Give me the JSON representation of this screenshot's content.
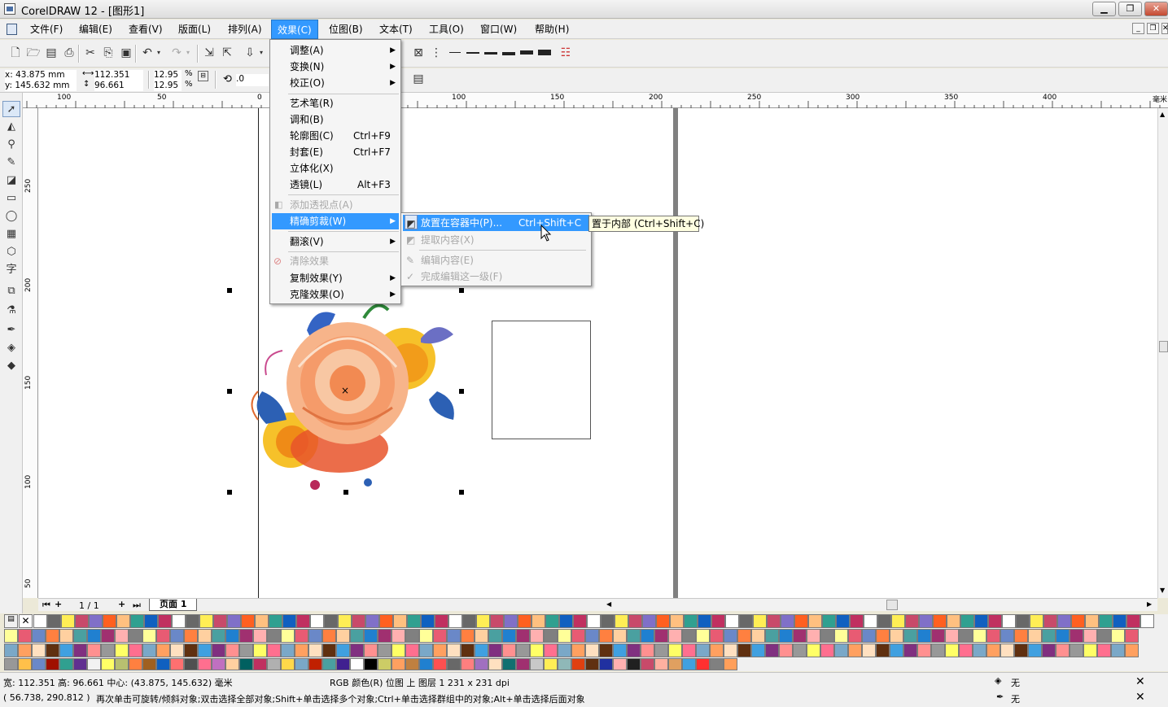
{
  "titlebar": {
    "title": "CorelDRAW 12 - [图形1]",
    "min": "▁",
    "restore": "❐",
    "close": "✕"
  },
  "menubar": {
    "items": [
      "文件(F)",
      "编辑(E)",
      "查看(V)",
      "版面(L)",
      "排列(A)",
      "效果(C)",
      "位图(B)",
      "文本(T)",
      "工具(O)",
      "窗口(W)",
      "帮助(H)"
    ],
    "mdi_min": "_",
    "mdi_restore": "❐",
    "mdi_close": "✕"
  },
  "propbar": {
    "x": "x: 43.875 mm",
    "y": "y: 145.632 mm",
    "width": "112.351 mm",
    "height": "96.661 mm",
    "scale_w": "12.95",
    "scale_h": "12.95",
    "pct": "%",
    "rotation": ".0"
  },
  "ruler": {
    "h_labels": [
      "100",
      "50",
      "0",
      "100",
      "150",
      "200",
      "250",
      "300",
      "350",
      "400"
    ],
    "h_unit": "毫米",
    "v_labels": [
      "250",
      "200",
      "150",
      "100",
      "50"
    ]
  },
  "effects_menu": {
    "items": [
      {
        "label": "调整(A)",
        "shortcut": "",
        "submenu": true,
        "disabled": false
      },
      {
        "label": "变换(N)",
        "shortcut": "",
        "submenu": true,
        "disabled": false
      },
      {
        "label": "校正(O)",
        "shortcut": "",
        "submenu": true,
        "disabled": false
      },
      {
        "label": "艺术笔(R)",
        "shortcut": "",
        "submenu": false,
        "disabled": false
      },
      {
        "label": "调和(B)",
        "shortcut": "",
        "submenu": false,
        "disabled": false
      },
      {
        "label": "轮廓图(C)",
        "shortcut": "Ctrl+F9",
        "submenu": false,
        "disabled": false
      },
      {
        "label": "封套(E)",
        "shortcut": "Ctrl+F7",
        "submenu": false,
        "disabled": false
      },
      {
        "label": "立体化(X)",
        "shortcut": "",
        "submenu": false,
        "disabled": false
      },
      {
        "label": "透镜(L)",
        "shortcut": "Alt+F3",
        "submenu": false,
        "disabled": false
      },
      {
        "label": "添加透视点(A)",
        "shortcut": "",
        "submenu": false,
        "disabled": true
      },
      {
        "label": "精确剪裁(W)",
        "shortcut": "",
        "submenu": true,
        "disabled": false
      },
      {
        "label": "翻滚(V)",
        "shortcut": "",
        "submenu": true,
        "disabled": false
      },
      {
        "label": "清除效果",
        "shortcut": "",
        "submenu": false,
        "disabled": true
      },
      {
        "label": "复制效果(Y)",
        "shortcut": "",
        "submenu": true,
        "disabled": false
      },
      {
        "label": "克隆效果(O)",
        "shortcut": "",
        "submenu": true,
        "disabled": false
      }
    ]
  },
  "powerclip_menu": {
    "items": [
      {
        "label": "放置在容器中(P)...",
        "shortcut": "Ctrl+Shift+C",
        "disabled": false
      },
      {
        "label": "提取内容(X)",
        "shortcut": "",
        "disabled": true
      },
      {
        "label": "编辑内容(E)",
        "shortcut": "",
        "disabled": true
      },
      {
        "label": "完成编辑这一级(F)",
        "shortcut": "",
        "disabled": true
      }
    ]
  },
  "tooltip": "置于内部 (Ctrl+Shift+C)",
  "pages": {
    "counter": "1 / 1",
    "tab": "页面 1"
  },
  "status": {
    "line1": "宽: 112.351  高: 96.661  中心: (43.875, 145.632)  毫米",
    "line1b": "RGB 颜色(R) 位图 上 图层 1 231 x 231 dpi",
    "line2": "( 56.738, 290.812 )",
    "line2b": "再次单击可旋转/倾斜对象;双击选择全部对象;Shift+单击选择多个对象;Ctrl+单击选择群组中的对象;Alt+单击选择后面对象",
    "fill": "无",
    "outline": "无"
  },
  "colors": {
    "accent": "#3399ff",
    "page_bg": "#ffffff",
    "chrome": "#f0f0f0"
  }
}
